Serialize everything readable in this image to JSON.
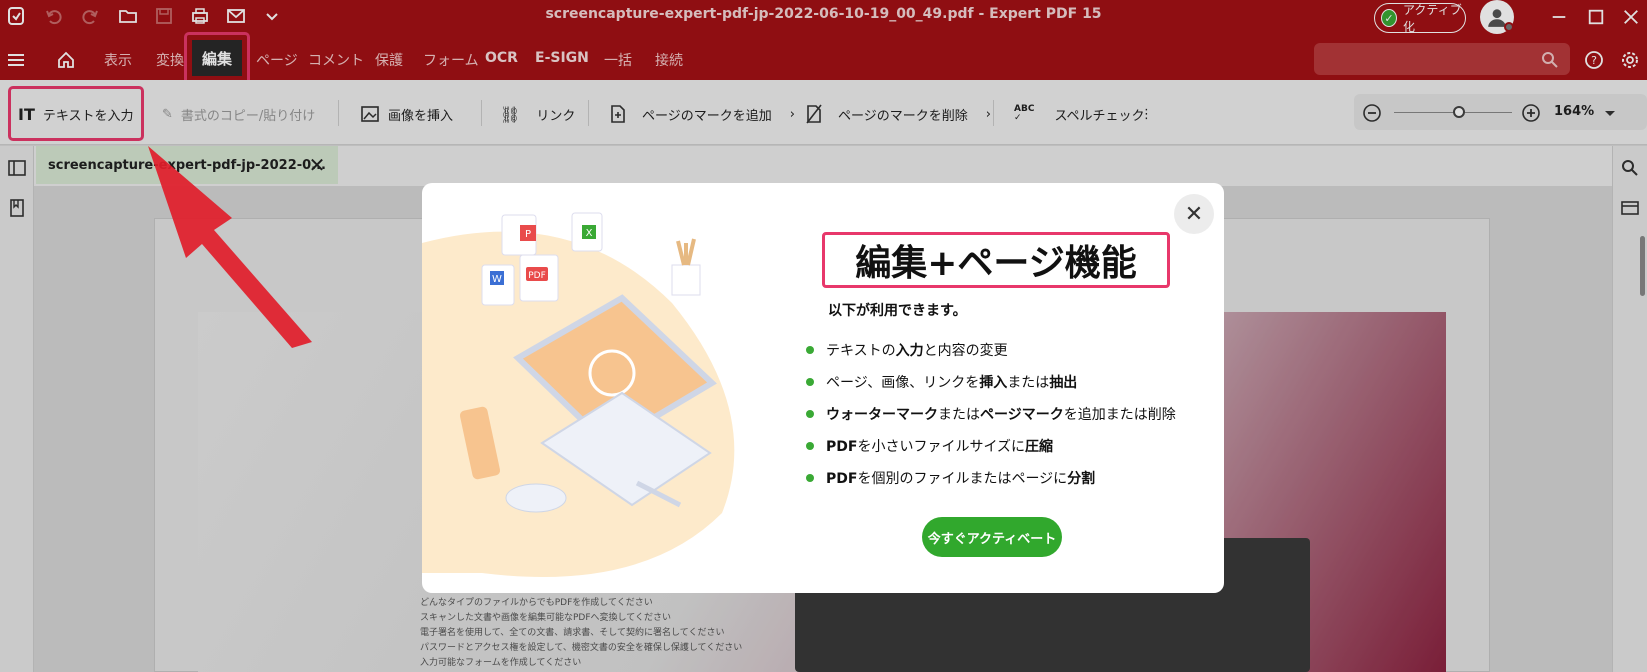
{
  "window": {
    "title": "screencapture-expert-pdf-jp-2022-06-10-19_00_49.pdf  -  Expert PDF 15",
    "activate_label": "アクティブ化"
  },
  "menubar": {
    "items": [
      "表示",
      "変換",
      "編集",
      "ページ",
      "コメント",
      "保護",
      "フォーム",
      "OCR",
      "E-SIGN",
      "一括",
      "接続"
    ],
    "active": "編集"
  },
  "toolbar": {
    "add_text": "テキストを入力",
    "copy_format": "書式のコピー/貼り付け",
    "insert_image": "画像を挿入",
    "link": "リンク",
    "add_page_mark": "ページのマークを追加",
    "remove_page_mark": "ページのマークを削除",
    "spellcheck": "スペルチェック",
    "zoom": "164%",
    "zoom_fraction": 0.55
  },
  "document_tab": {
    "label": "screencapture-expert-pdf-jp-2022-0..."
  },
  "page_text_lines": [
    "どんなタイプのファイルからでもPDFを作成してください",
    "スキャンした文書や画像を編集可能なPDFへ変換してください",
    "電子署名を使用して、全ての文書、請求書、そして契約に署名してください",
    "パスワードとアクセス権を設定して、機密文書の安全を確保し保護してください",
    "入力可能なフォームを作成してください"
  ],
  "modal": {
    "title": "編集+ページ機能",
    "subtitle": "以下が利用できます。",
    "features": [
      {
        "pre": "テキストの",
        "bold": "入力",
        "post": "と内容の変更"
      },
      {
        "pre": "ページ、画像、リンクを",
        "bold": "挿入",
        "post": "または",
        "bold2": "抽出"
      },
      {
        "pre": "",
        "bold": "ウォーターマーク",
        "post": "または",
        "bold2": "ページマーク",
        "post2": "を追加または削除"
      },
      {
        "pre": "",
        "bold": "PDF",
        "post": "を小さいファイルサイズに",
        "bold2": "圧縮"
      },
      {
        "pre": "",
        "bold": "PDF",
        "post": "を個別のファイルまたはページに",
        "bold2": "分割"
      }
    ],
    "cta": "今すぐアクティベート",
    "illustration_labels": [
      "W",
      "P",
      "X",
      "PDF"
    ]
  },
  "colors": {
    "titlebar": "#a31115",
    "highlight": "#e8386b",
    "accent_green": "#31a82d"
  }
}
